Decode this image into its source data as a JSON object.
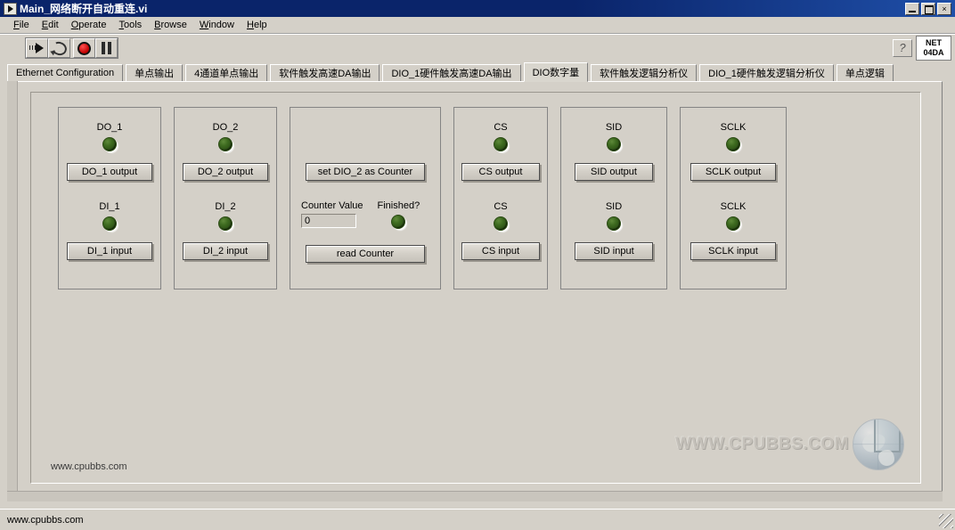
{
  "window": {
    "title": "Main_网络断开自动重连.vi",
    "icon": "labview-vi-icon",
    "minimize_label": "Minimize",
    "maximize_label": "Maximize",
    "close_label": "×"
  },
  "menu": {
    "items": [
      {
        "label": "File",
        "accel": "F"
      },
      {
        "label": "Edit",
        "accel": "E"
      },
      {
        "label": "Operate",
        "accel": "O"
      },
      {
        "label": "Tools",
        "accel": "T"
      },
      {
        "label": "Browse",
        "accel": "B"
      },
      {
        "label": "Window",
        "accel": "W"
      },
      {
        "label": "Help",
        "accel": "H"
      }
    ]
  },
  "toolbar": {
    "buttons": [
      {
        "name": "run-button",
        "icon": "run-arrow-icon"
      },
      {
        "name": "run-continuously-button",
        "icon": "run-loop-icon"
      },
      {
        "name": "abort-button",
        "icon": "abort-stop-icon"
      },
      {
        "name": "pause-button",
        "icon": "pause-icon"
      }
    ],
    "help_label": "?",
    "net_box_line1": "NET",
    "net_box_line2": "04DA"
  },
  "tabs": {
    "items": [
      {
        "label": "Ethernet Configuration",
        "active": false
      },
      {
        "label": "单点输出",
        "active": false
      },
      {
        "label": "4通道单点输出",
        "active": false
      },
      {
        "label": "软件触发高速DA输出",
        "active": false
      },
      {
        "label": "DIO_1硬件触发高速DA输出",
        "active": false
      },
      {
        "label": "DIO数字量",
        "active": true
      },
      {
        "label": "软件触发逻辑分析仪",
        "active": false
      },
      {
        "label": "DIO_1硬件触发逻辑分析仪",
        "active": false
      },
      {
        "label": "单点逻辑",
        "active": false
      }
    ]
  },
  "panels": [
    {
      "name": "do1-di1-group",
      "type": "pair",
      "top": {
        "led_label": "DO_1",
        "button_label": "DO_1 output",
        "led_state": "off"
      },
      "bottom": {
        "led_label": "DI_1",
        "button_label": "DI_1 input",
        "led_state": "off"
      }
    },
    {
      "name": "do2-di2-group",
      "type": "pair",
      "top": {
        "led_label": "DO_2",
        "button_label": "DO_2 output",
        "led_state": "off"
      },
      "bottom": {
        "led_label": "DI_2",
        "button_label": "DI_2 input",
        "led_state": "off"
      }
    },
    {
      "name": "counter-group",
      "type": "counter",
      "set_counter_button": "set DIO_2 as Counter",
      "counter_value_label": "Counter Value",
      "counter_value": "0",
      "finished_label": "Finished?",
      "finished_led_state": "off",
      "read_counter_button": "read Counter"
    },
    {
      "name": "cs-group",
      "type": "pair",
      "top": {
        "led_label": "CS",
        "button_label": "CS output",
        "led_state": "off"
      },
      "bottom": {
        "led_label": "CS",
        "button_label": "CS input",
        "led_state": "off"
      }
    },
    {
      "name": "sid-group",
      "type": "pair",
      "top": {
        "led_label": "SID",
        "button_label": "SID output",
        "led_state": "off"
      },
      "bottom": {
        "led_label": "SID",
        "button_label": "SID input",
        "led_state": "off"
      }
    },
    {
      "name": "sclk-group",
      "type": "pair",
      "top": {
        "led_label": "SCLK",
        "button_label": "SCLK output",
        "led_state": "off"
      },
      "bottom": {
        "led_label": "SCLK",
        "button_label": "SCLK input",
        "led_state": "off"
      }
    }
  ],
  "watermarks": {
    "panel_text": "www.cpubbs.com",
    "corner_text": "WWW.CPUBBS.COM",
    "corner_icon": "globe-icon"
  },
  "statusbar": {
    "text": "www.cpubbs.com"
  },
  "colors": {
    "titlebar": "#0a246a",
    "window_face": "#d4d0c8",
    "led_off_green": "#3e6b20",
    "abort_red": "#c00000"
  }
}
